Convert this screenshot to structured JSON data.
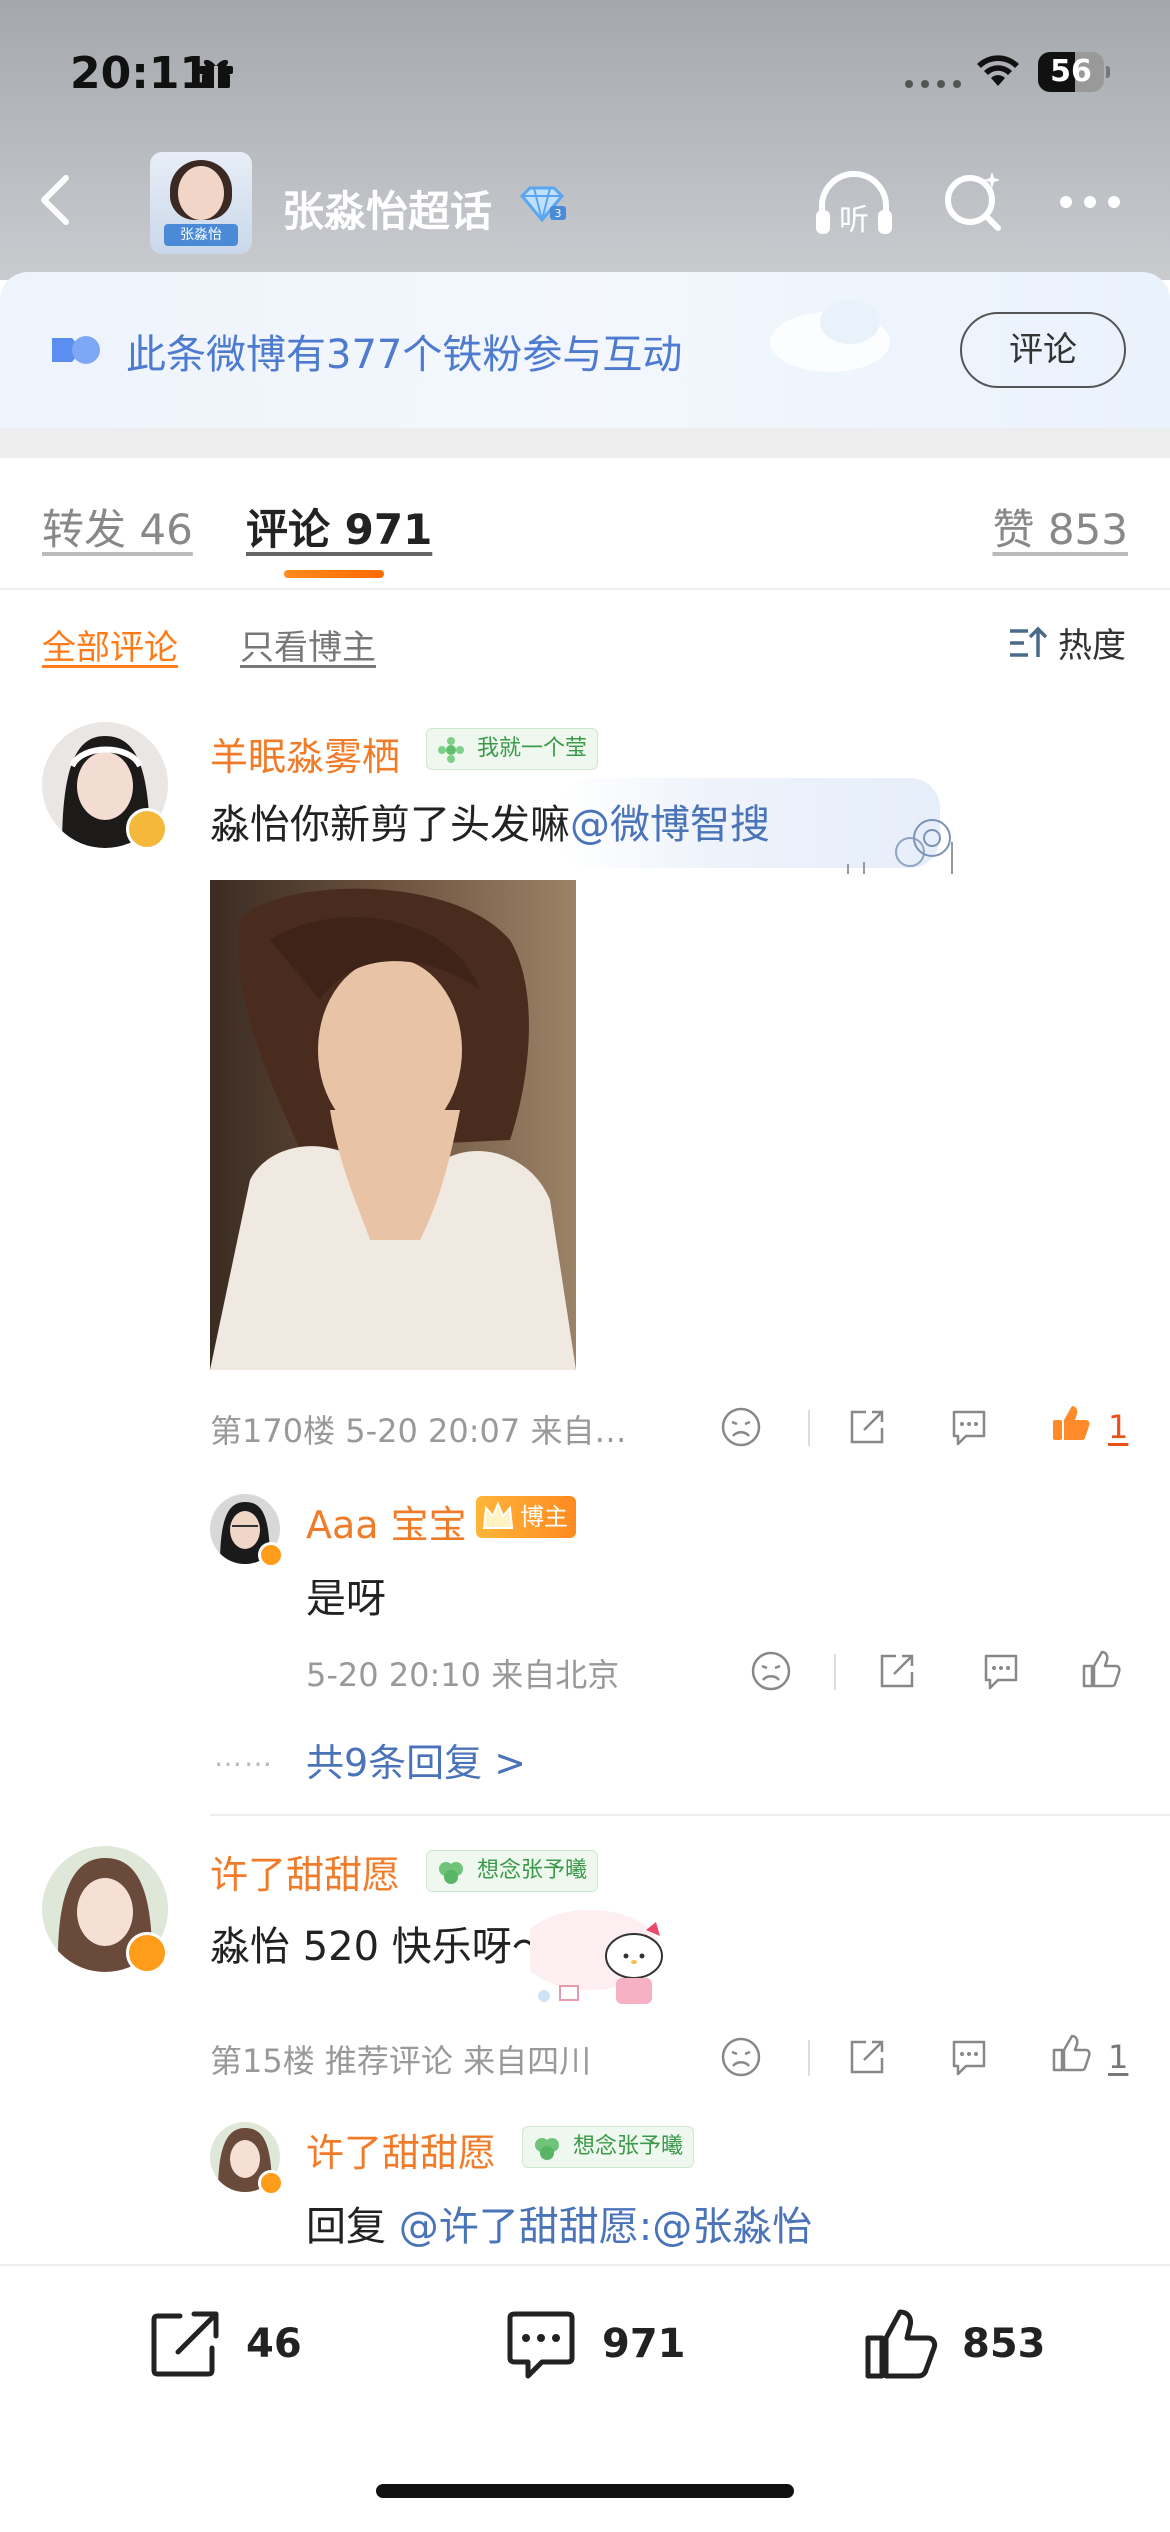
{
  "status_bar": {
    "time": "20:11",
    "battery": "56",
    "battery_level": 0.56
  },
  "nav": {
    "title": "张淼怡超话",
    "avatar_tag": "张淼怡",
    "listen_label": "听"
  },
  "fan_banner": {
    "text": "此条微博有377个铁粉参与互动",
    "button": "评论"
  },
  "tabs": {
    "repost": "转发 46",
    "comment": "评论 971",
    "like": "赞 853"
  },
  "filter": {
    "all": "全部评论",
    "blogger_only": "只看博主",
    "sort": "热度"
  },
  "comments": [
    {
      "username": "羊眠淼雾栖",
      "fan_tag": "我就一个莹",
      "text_prefix": "淼怡你新剪了头发嘛",
      "mention": "@微博智搜",
      "meta": "第170楼  5-20 20:07  来自…",
      "like_count": "1",
      "reply": {
        "username": "Aaa 宝宝",
        "badge": "博主",
        "text": "是呀",
        "meta": "5-20 20:10  来自北京"
      },
      "more_replies": "共9条回复 >",
      "dots": "……"
    },
    {
      "username": "许了甜甜愿",
      "fan_tag": "想念张予曦",
      "text": "淼怡 520 快乐呀～",
      "meta": "第15楼  推荐评论  来自四川",
      "like_count": "1",
      "reply": {
        "username": "许了甜甜愿",
        "fan_tag": "想念张予曦",
        "text_prefix": "回复 ",
        "mention": "@许了甜甜愿:@张淼怡"
      }
    }
  ],
  "bottom_bar": {
    "repost_count": "46",
    "comment_count": "971",
    "like_count": "853"
  },
  "colors": {
    "accent_orange": "#f07c2a",
    "link_blue": "#4a73b8",
    "like_red": "#e8521a"
  }
}
